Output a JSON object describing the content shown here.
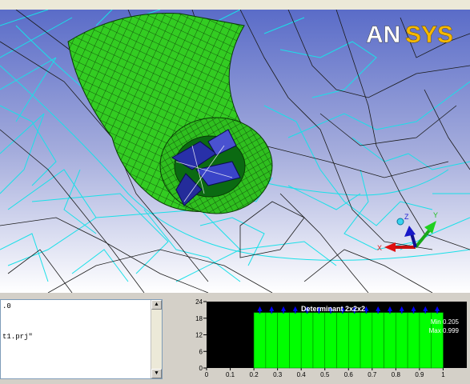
{
  "window": {
    "title": ""
  },
  "brand": {
    "logo_text": "ANSYS"
  },
  "triad": {
    "x_label": "X",
    "y_label": "Y",
    "z_label": "Z"
  },
  "message_log": {
    "lines": [
      ".0",
      "",
      "",
      "t1.prj\"",
      ""
    ]
  },
  "histogram": {
    "title": "Determinant 2x2x2",
    "min_label": "Min 0.205",
    "max_label": "Max 0.999"
  },
  "chart_data": {
    "type": "bar",
    "title": "Determinant 2x2x2",
    "xlabel": "",
    "ylabel": "",
    "x": [
      0.2,
      0.25,
      0.3,
      0.35,
      0.4,
      0.45,
      0.5,
      0.55,
      0.6,
      0.65,
      0.7,
      0.75,
      0.8,
      0.85,
      0.9,
      0.95
    ],
    "values": [
      20,
      20,
      20,
      20,
      20,
      20,
      20,
      20,
      20,
      20,
      20,
      20,
      20,
      20,
      20,
      20
    ],
    "bar_width": 0.05,
    "xlim": [
      0,
      1.1
    ],
    "ylim": [
      0,
      24
    ],
    "x_ticks": [
      "0",
      "0.1",
      "0.2",
      "0.3",
      "0.4",
      "0.5",
      "0.6",
      "0.7",
      "0.8",
      "0.9",
      "1"
    ],
    "y_ticks": [
      "0",
      "6",
      "12",
      "18",
      "24"
    ],
    "min": 0.205,
    "max": 0.999,
    "bar_color": "#00ff00",
    "background": "#000000",
    "marker_color": "#0000ff",
    "grid": false
  }
}
